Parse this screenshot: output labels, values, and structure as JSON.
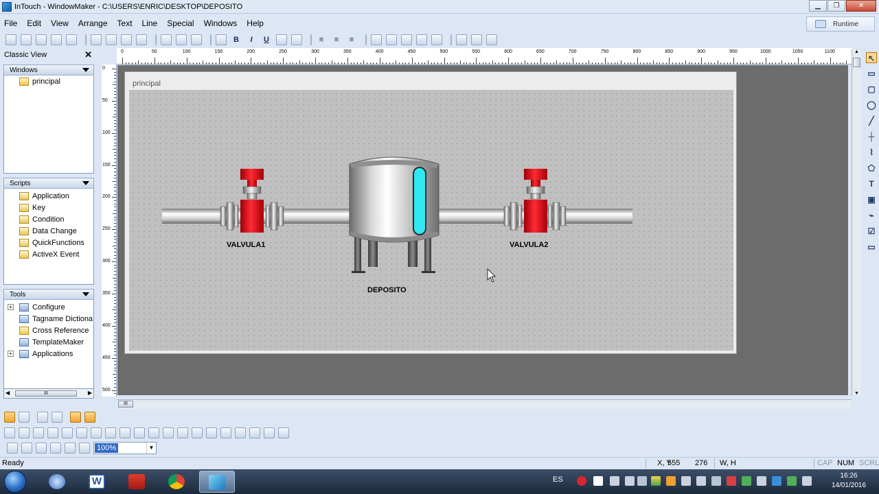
{
  "window": {
    "title": "InTouch - WindowMaker - C:\\USERS\\ENRIC\\DESKTOP\\DEPOSITO",
    "controls": [
      "minimize",
      "maximize",
      "close"
    ]
  },
  "menu": [
    "File",
    "Edit",
    "View",
    "Arrange",
    "Text",
    "Line",
    "Special",
    "Windows",
    "Help"
  ],
  "runtime_button": "Runtime",
  "classic_view": {
    "title": "Classic View",
    "windows_section": {
      "label": "Windows",
      "items": [
        "principal"
      ]
    },
    "scripts_section": {
      "label": "Scripts",
      "items": [
        "Application",
        "Key",
        "Condition",
        "Data Change",
        "QuickFunctions",
        "ActiveX Event"
      ]
    },
    "tools_section": {
      "label": "Tools",
      "items": [
        "Configure",
        "Tagname Dictiona",
        "Cross Reference",
        "TemplateMaker",
        "Applications"
      ]
    },
    "scroll_label": "III"
  },
  "ruler": {
    "top_labels": [
      "0",
      "50",
      "100",
      "150",
      "200",
      "250",
      "300",
      "350",
      "400",
      "450",
      "500",
      "550",
      "600",
      "650",
      "700",
      "750",
      "800",
      "850",
      "900",
      "950",
      "1000",
      "1050",
      "1100"
    ],
    "left_labels": [
      "0",
      "50",
      "100",
      "150",
      "200",
      "250",
      "300",
      "350",
      "400",
      "450",
      "500"
    ]
  },
  "canvas_window": {
    "title": "principal",
    "labels": {
      "valve1": "VALVULA1",
      "valve2": "VALVULA2",
      "tank": "DEPOSITO"
    }
  },
  "zoom": {
    "value": "100%"
  },
  "status": {
    "ready": "Ready",
    "xy_label": "X, Y",
    "x": "555",
    "y": "276",
    "wh_label": "W, H",
    "caps": "CAP",
    "num": "NUM",
    "scrl": "SCRL"
  },
  "taskbar": {
    "lang": "ES",
    "time": "16:26",
    "date": "14/01/2016"
  },
  "colors": {
    "valve_red": "#e8121c",
    "tank_level": "#2ee9f2",
    "workspace": "#6c6c6c",
    "canvas": "#c0c0c0"
  }
}
